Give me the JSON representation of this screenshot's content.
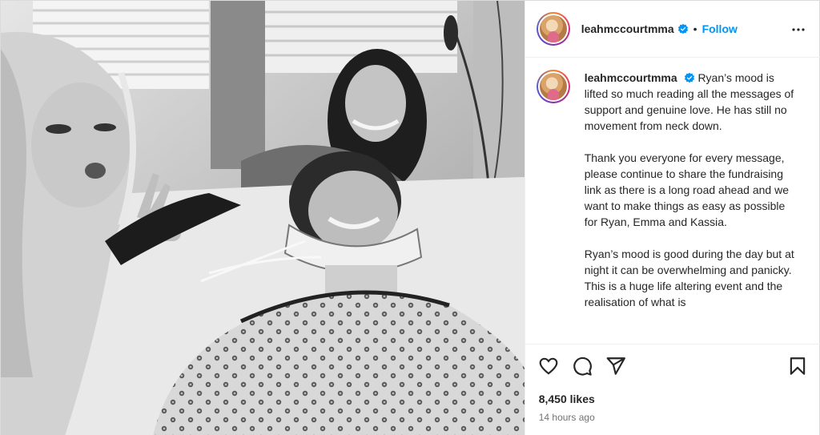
{
  "post": {
    "photo_alt": "",
    "header": {
      "username": "leahmccourtmma",
      "separator": "•",
      "follow_label": "Follow"
    },
    "caption": {
      "username": "leahmccourtmma",
      "paragraphs": [
        "Ryan’s mood is lifted so much reading all the messages of support and genuine love. He has still no movement from neck down.",
        "Thank you everyone for every message, please continue to share the fundraising link as there is a long road ahead and we want to make things as easy as possible for Ryan, Emma and Kassia.",
        "Ryan’s mood is good during the day but at night it can be overwhelming and panicky. This is a huge life altering event and the realisation of what is"
      ]
    },
    "likes": "8,450 likes",
    "timestamp": "14 hours ago",
    "icons": {
      "like": "heart-icon",
      "comment": "comment-icon",
      "share": "share-icon",
      "save": "bookmark-icon",
      "more": "more-options-icon",
      "verified": "verified-badge-icon"
    },
    "colors": {
      "accent": "#0095f6",
      "text": "#262626",
      "muted": "#737373",
      "border": "#efefef"
    }
  }
}
